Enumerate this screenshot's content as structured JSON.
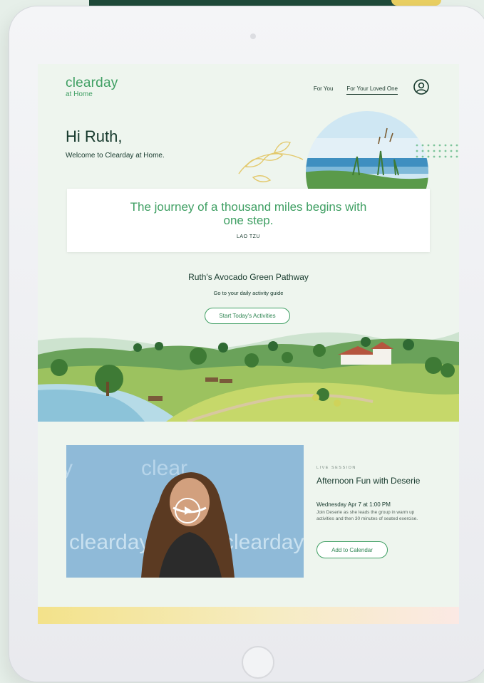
{
  "brand": {
    "name": "clearday",
    "sub": "at Home"
  },
  "nav": {
    "items": [
      {
        "label": "For You"
      },
      {
        "label": "For Your Loved One"
      }
    ]
  },
  "hero": {
    "greeting": "Hi Ruth,",
    "welcome": "Welcome to Clearday at Home."
  },
  "quote": {
    "text": "The journey of a thousand miles begins with one step.",
    "author": "LAO TZU"
  },
  "pathway": {
    "title": "Ruth's Avocado Green Pathway",
    "subtitle": "Go to your daily activity guide",
    "button": "Start Today's Activities"
  },
  "live": {
    "label": "LIVE SESSION",
    "title": "Afternoon Fun with Deserie",
    "date": "Wednesday Apr 7 at 1:00 PM",
    "description": "Join Deserie as she leads the group in warm up activities and then 30 minutes of seated exercise.",
    "button": "Add to Calendar",
    "video_backdrop_words": [
      "clear",
      "clearday",
      "clearday",
      "y"
    ]
  },
  "colors": {
    "accent": "#3f9f63",
    "dark_text": "#173a2d",
    "screen_bg": "#eef5ee"
  },
  "icons": {
    "account": "user-circle-icon",
    "play": "play-icon"
  }
}
